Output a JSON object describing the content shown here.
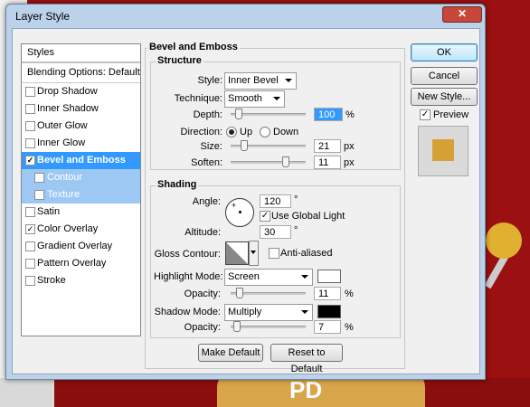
{
  "window": {
    "title": "Layer Style",
    "close_glyph": "✕"
  },
  "styles_panel": {
    "header": "Styles",
    "blending": "Blending Options: Default",
    "items": [
      {
        "label": "Drop Shadow",
        "checked": false
      },
      {
        "label": "Inner Shadow",
        "checked": false
      },
      {
        "label": "Outer Glow",
        "checked": false
      },
      {
        "label": "Inner Glow",
        "checked": false
      },
      {
        "label": "Bevel and Emboss",
        "checked": true,
        "selected": true
      },
      {
        "label": "Contour",
        "checked": false,
        "sub": true
      },
      {
        "label": "Texture",
        "checked": false,
        "sub": true
      },
      {
        "label": "Satin",
        "checked": false
      },
      {
        "label": "Color Overlay",
        "checked": true
      },
      {
        "label": "Gradient Overlay",
        "checked": false
      },
      {
        "label": "Pattern Overlay",
        "checked": false
      },
      {
        "label": "Stroke",
        "checked": false
      }
    ]
  },
  "bevel": {
    "section_title": "Bevel and Emboss",
    "structure": {
      "title": "Structure",
      "style_label": "Style:",
      "style_value": "Inner Bevel",
      "technique_label": "Technique:",
      "technique_value": "Smooth",
      "depth_label": "Depth:",
      "depth_value": "100",
      "depth_unit": "%",
      "depth_slider": 0.1,
      "direction_label": "Direction:",
      "dir_up": "Up",
      "dir_down": "Down",
      "direction_selected": "Up",
      "size_label": "Size:",
      "size_value": "21",
      "size_unit": "px",
      "size_slider": 0.17,
      "soften_label": "Soften:",
      "soften_value": "11",
      "soften_unit": "px",
      "soften_slider": 0.72
    },
    "shading": {
      "title": "Shading",
      "angle_label": "Angle:",
      "angle_value": "120",
      "angle_unit": "°",
      "global_light_label": "Use Global Light",
      "global_light_checked": true,
      "altitude_label": "Altitude:",
      "altitude_value": "30",
      "altitude_unit": "°",
      "gloss_label": "Gloss Contour:",
      "anti_aliased_label": "Anti-aliased",
      "anti_aliased_checked": false,
      "highlight_mode_label": "Highlight Mode:",
      "highlight_mode_value": "Screen",
      "highlight_color": "#ffffff",
      "highlight_opacity_label": "Opacity:",
      "highlight_opacity_value": "11",
      "highlight_opacity_unit": "%",
      "highlight_opacity_slider": 0.11,
      "shadow_mode_label": "Shadow Mode:",
      "shadow_mode_value": "Multiply",
      "shadow_color": "#000000",
      "shadow_opacity_label": "Opacity:",
      "shadow_opacity_value": "7",
      "shadow_opacity_unit": "%",
      "shadow_opacity_slider": 0.07
    },
    "make_default": "Make Default",
    "reset_default": "Reset to Default"
  },
  "side": {
    "ok": "OK",
    "cancel": "Cancel",
    "new_style": "New Style...",
    "preview_label": "Preview",
    "preview_checked": true,
    "preview_color": "#d6a034"
  },
  "background": {
    "logo_text": "PD"
  }
}
